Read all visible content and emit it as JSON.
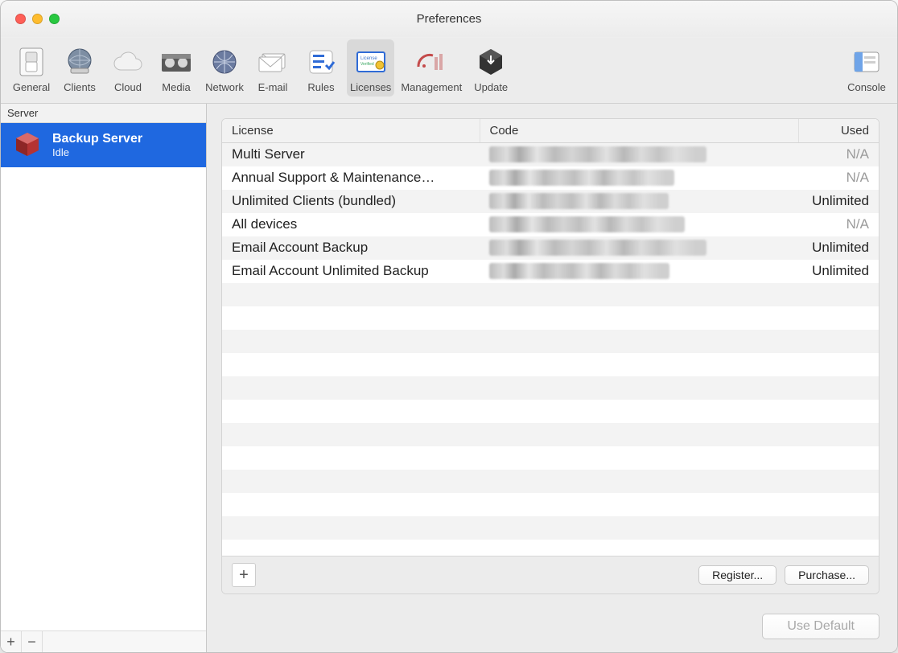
{
  "window": {
    "title": "Preferences"
  },
  "toolbar": {
    "items": [
      {
        "id": "general",
        "label": "General"
      },
      {
        "id": "clients",
        "label": "Clients"
      },
      {
        "id": "cloud",
        "label": "Cloud"
      },
      {
        "id": "media",
        "label": "Media"
      },
      {
        "id": "network",
        "label": "Network"
      },
      {
        "id": "email",
        "label": "E-mail"
      },
      {
        "id": "rules",
        "label": "Rules"
      },
      {
        "id": "licenses",
        "label": "Licenses"
      },
      {
        "id": "management",
        "label": "Management"
      },
      {
        "id": "update",
        "label": "Update"
      },
      {
        "id": "console",
        "label": "Console"
      }
    ],
    "selected": "licenses"
  },
  "sidebar": {
    "header": "Server",
    "server": {
      "name": "Backup Server",
      "status": "Idle"
    }
  },
  "licenses_table": {
    "columns": {
      "license": "License",
      "code": "Code",
      "used": "Used"
    },
    "rows": [
      {
        "license": "Multi Server",
        "code": "[redacted]",
        "used": "N/A",
        "used_dim": true
      },
      {
        "license": "Annual Support & Maintenance…",
        "code": "[redacted]",
        "used": "N/A",
        "used_dim": true
      },
      {
        "license": "Unlimited Clients (bundled)",
        "code": "[redacted]",
        "used": "Unlimited",
        "used_dim": false
      },
      {
        "license": "All devices",
        "code": "[redacted]",
        "used": "N/A",
        "used_dim": true
      },
      {
        "license": "Email Account Backup",
        "code": "[redacted]",
        "used": "Unlimited",
        "used_dim": false
      },
      {
        "license": "Email Account Unlimited Backup",
        "code": "[redacted]",
        "used": "Unlimited",
        "used_dim": false
      }
    ]
  },
  "buttons": {
    "register": "Register...",
    "purchase": "Purchase...",
    "use_default": "Use Default"
  }
}
